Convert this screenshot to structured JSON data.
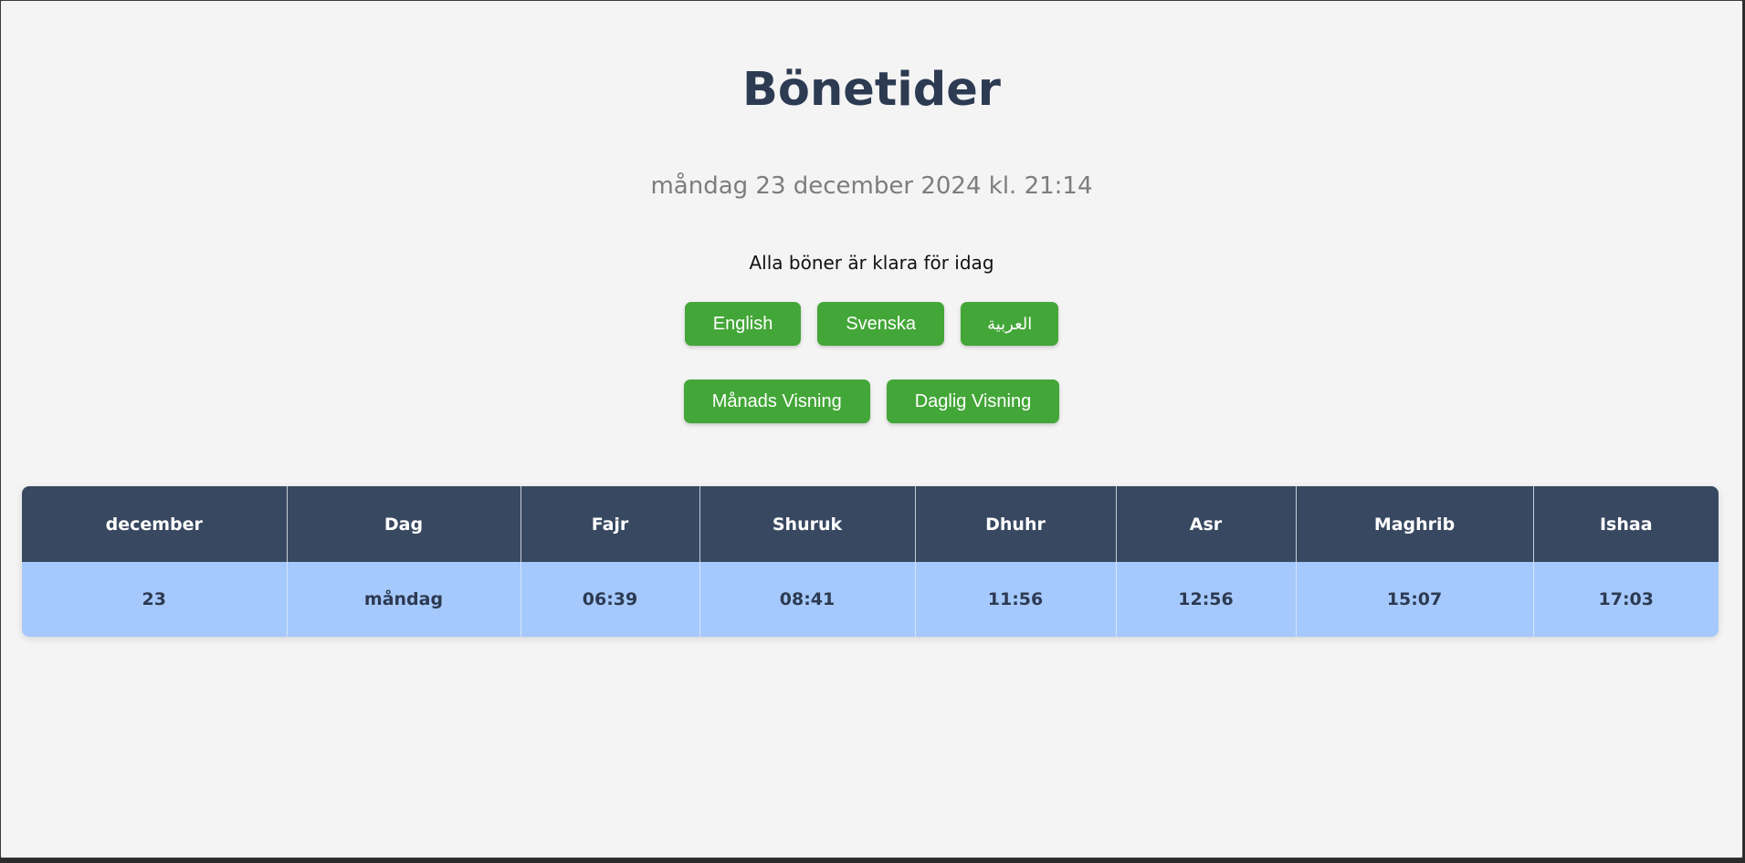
{
  "title": "Bönetider",
  "datetime": "måndag 23 december 2024 kl. 21:14",
  "status": "Alla böner är klara för idag",
  "language_buttons": [
    "English",
    "Svenska",
    "العربية"
  ],
  "view_buttons": [
    "Månads Visning",
    "Daglig Visning"
  ],
  "table": {
    "headers": [
      "december",
      "Dag",
      "Fajr",
      "Shuruk",
      "Dhuhr",
      "Asr",
      "Maghrib",
      "Ishaa"
    ],
    "rows": [
      [
        "23",
        "måndag",
        "06:39",
        "08:41",
        "11:56",
        "12:56",
        "15:07",
        "17:03"
      ]
    ]
  },
  "colors": {
    "background": "#f4f4f4",
    "title": "#2c3a52",
    "button": "#43a638",
    "table_header": "#384861",
    "table_row_highlight": "#a6c9fd"
  }
}
